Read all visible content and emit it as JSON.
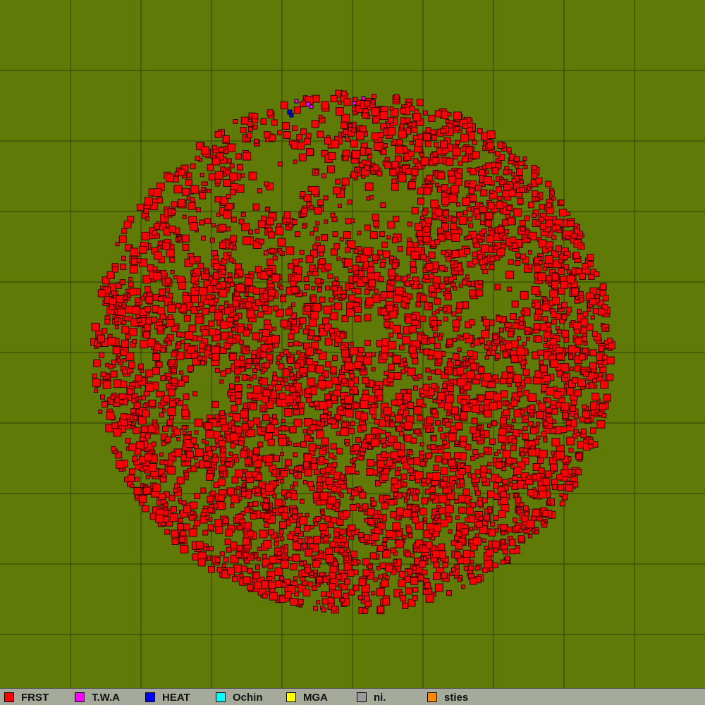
{
  "colors": {
    "terrain": "#5f7a07",
    "grid_line": "#2f3f05",
    "unit_outline": "#3a0000",
    "legend_bg": "#a6aa9a"
  },
  "legend": [
    {
      "label": "FRST",
      "color": "#ff0000"
    },
    {
      "label": "T.W.A",
      "color": "#ff00ff"
    },
    {
      "label": "HEAT",
      "color": "#0000ff"
    },
    {
      "label": "Ochin",
      "color": "#00ffff"
    },
    {
      "label": "MGA",
      "color": "#ffff00"
    },
    {
      "label": "ni.",
      "color": "#9a9a9a"
    },
    {
      "label": "sties",
      "color": "#ff8800"
    }
  ],
  "territory": {
    "owner": "FRST",
    "shape": "disc",
    "density": "high"
  },
  "minor_units": [
    {
      "owner": "T.W.A",
      "color": "#ff00ff"
    },
    {
      "owner": "HEAT",
      "color": "#0000ff"
    }
  ]
}
